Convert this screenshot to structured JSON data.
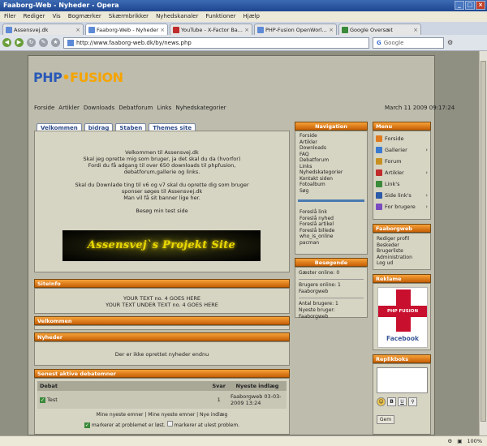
{
  "window": {
    "title": "Faaborg-Web - Nyheder - Opera"
  },
  "menubar": [
    "Filer",
    "Rediger",
    "Vis",
    "Bogmærker",
    "Skærmbrikker",
    "Nyhedskanaler",
    "Funktioner",
    "Hjælp"
  ],
  "tabs": [
    {
      "label": "Assensvej.dk"
    },
    {
      "label": "Faaborg-Web - Nyheder"
    },
    {
      "label": "YouTube - X-Factor Ba..."
    },
    {
      "label": "PHP-Fusion OpenWorl..."
    },
    {
      "label": "Google Oversæt"
    }
  ],
  "address": {
    "url": "http://www.faaborg-web.dk/by/news.php",
    "search_placeholder": "Google"
  },
  "site": {
    "logo_left": "PHP",
    "logo_right": "FUSION",
    "nav": [
      "Forside",
      "Artikler",
      "Downloads",
      "Debatforum",
      "Links",
      "Nyhedskategorier"
    ],
    "datetime": "March 11 2009 09:17:24",
    "panel_tabs": [
      "Velkommen",
      "bidrag",
      "Staben",
      "Themes site"
    ],
    "welcome_lines": [
      "Velkommen til Assensvej.dk",
      "Skal jeg oprette mig som bruger, ja det skal du da (hvorfor)",
      "Fordi du få adgang til over 650 downloads til phpfusion,",
      "debatforum,gallerie og links.",
      "",
      "Skal du Downlade ting til v6 og v7 skal du oprette dig som bruger",
      "sponser søges til Assensvej.dk",
      "Man vil få sit banner lige her.",
      "",
      "Besøg min test side"
    ],
    "banner_text": "Assensvej`s Projekt Site",
    "siteinfo": {
      "title": "SiteInfo",
      "line1": "YOUR TEXT no. 4 GOES HERE",
      "line2": "YOUR TEXT UNDER TEXT no. 4 GOES HERE"
    },
    "welcome_bar": "Velkommen",
    "news": {
      "title": "Nyheder",
      "empty": "Der er ikke oprettet nyheder endnu"
    },
    "forum": {
      "title": "Senest aktive debatemner",
      "headers": [
        "Debat",
        "Svar",
        "Nyeste indlæg"
      ],
      "rows": [
        {
          "topic": "Test",
          "replies": "1",
          "author": "Faaborgweb",
          "date": "03-03-2009 13:24"
        }
      ],
      "links": "Mine nyeste emner | Mine nyeste emner | Nye indlæg",
      "legend_read": "markerer at problemet er løst.",
      "legend_unread": "markerer at ulest problem."
    },
    "navigation": {
      "title": "Navigation",
      "links": [
        "Forside",
        "Artikler",
        "Downloads",
        "FAQ",
        "Debatforum",
        "Links",
        "Nyhedskategorier",
        "Kontakt siden",
        "Fotoalbum",
        "Søg"
      ],
      "suggest": [
        "Foreslå link",
        "Foreslå nyhed",
        "Foreslå artikel",
        "Foreslå billede",
        "who_is_online",
        "pacman"
      ]
    },
    "visitors": {
      "title": "Besøgende",
      "guests": "Gæster online: 0",
      "members": "Brugere online: 1",
      "member_name": "Faaborgweb",
      "total": "Antal brugere: 1",
      "newest": "Nyeste bruger: Faaborgweb"
    },
    "menu": {
      "title": "Menu",
      "items": [
        {
          "label": "Forside",
          "color": "#e07b20",
          "sub": false
        },
        {
          "label": "Gallerier",
          "color": "#3a7ad0",
          "sub": true
        },
        {
          "label": "Forum",
          "color": "#c89020",
          "sub": false
        },
        {
          "label": "Artikler",
          "color": "#c02b2b",
          "sub": true
        },
        {
          "label": "Link's",
          "color": "#3a8a3a",
          "sub": false
        },
        {
          "label": "Side link's",
          "color": "#2b5aa8",
          "sub": true
        },
        {
          "label": "For brugere",
          "color": "#7a4ac0",
          "sub": true
        }
      ]
    },
    "faaborgweb": {
      "title": "Faaborgweb",
      "links": [
        "Rediger profil",
        "Beskeder",
        "Brugerliste",
        "Administration",
        "Log ud"
      ]
    },
    "reklame": {
      "title": "Reklame",
      "logo_text": "PHP FUSION",
      "facebook": "Facebook"
    },
    "replikboks": {
      "title": "Replikboks",
      "send_label": "Gem"
    }
  },
  "status": {
    "zoom": "100%"
  }
}
